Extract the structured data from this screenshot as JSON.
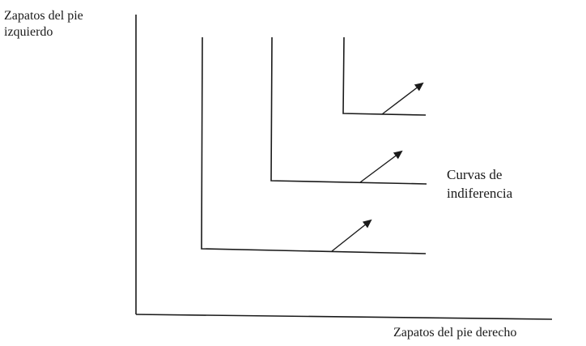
{
  "diagram": {
    "y_axis_label": [
      "Zapatos del pie",
      "izquierdo"
    ],
    "x_axis_label": "Zapatos del pie derecho",
    "curves_label": [
      "Curvas de",
      "indiferencia"
    ],
    "line_color": "#1a1a1a",
    "indifference_curves": [
      {
        "corner": "lower"
      },
      {
        "corner": "middle"
      },
      {
        "corner": "upper"
      }
    ],
    "preference_arrows": 3
  }
}
